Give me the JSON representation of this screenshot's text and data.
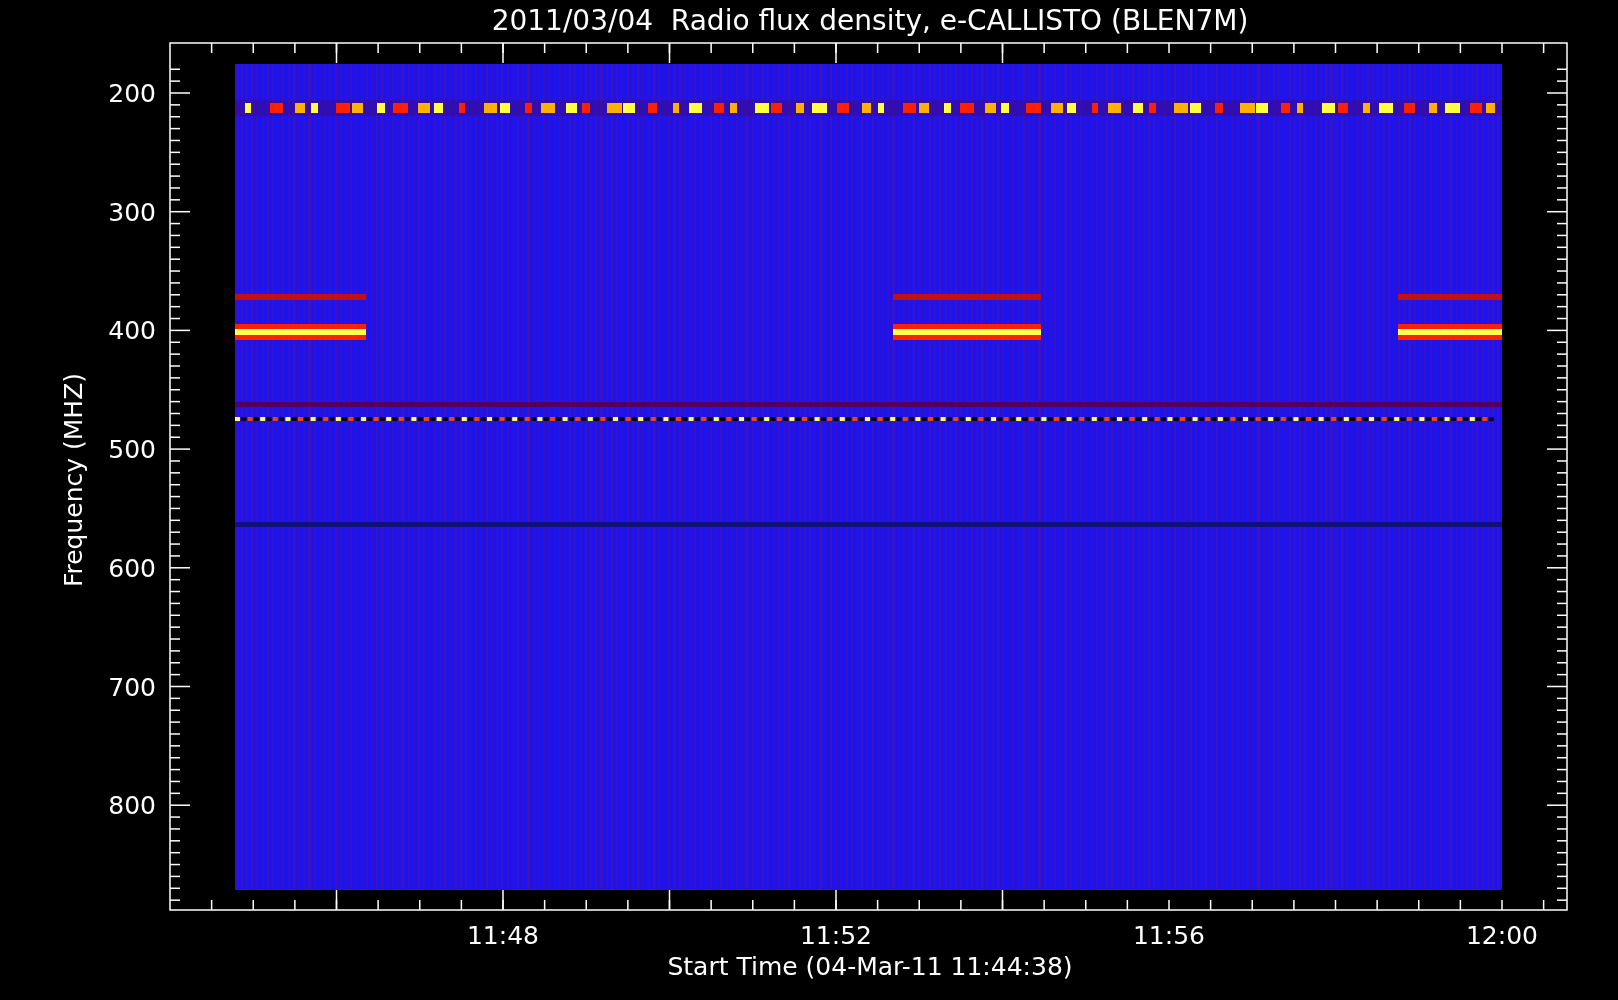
{
  "title": "2011/03/04  Radio flux density, e-CALLISTO (BLEN7M)",
  "ylabel": "Frequency (MHZ)",
  "xlabel": "Start Time (04-Mar-11 11:44:38)",
  "yticks": [
    "200",
    "300",
    "400",
    "500",
    "600",
    "700",
    "800"
  ],
  "xticks": [
    "11:48",
    "11:52",
    "11:56",
    "12:00"
  ]
}
